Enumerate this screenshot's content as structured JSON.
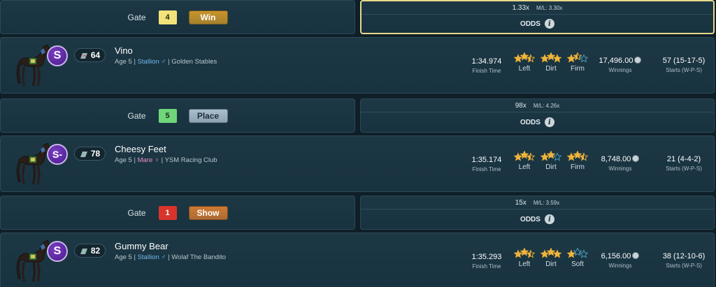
{
  "rows": [
    {
      "gate": {
        "label": "Gate",
        "number": "4",
        "number_bg": "#f3e27a",
        "result": "Win",
        "result_bg": "#c9942a"
      },
      "odds": {
        "value": "1.33x",
        "ml": "M/L: 3.30x",
        "label": "ODDS",
        "highlight": true
      },
      "horse": {
        "grade": "S",
        "rating": "64",
        "rating_trend": "down",
        "name": "Vino",
        "age": "Age 5",
        "gender": "Stallion ♂",
        "gender_type": "stallion",
        "stable": "Golden Stables",
        "finish_time": "1:34.974",
        "finish_time_caption": "Finish Time",
        "prefs": [
          {
            "label": "Left",
            "stars": 2.5
          },
          {
            "label": "Dirt",
            "stars": 3
          },
          {
            "label": "Firm",
            "stars": 1.5
          }
        ],
        "winnings": "17,496.00",
        "winnings_caption": "Winnings",
        "starts": "57 (15-17-5)",
        "starts_caption": "Starts (W-P-S)"
      }
    },
    {
      "gate": {
        "label": "Gate",
        "number": "5",
        "number_bg": "#6fd67a",
        "result": "Place",
        "result_bg": "#a9bfcf"
      },
      "odds": {
        "value": "98x",
        "ml": "M/L: 4.26x",
        "label": "ODDS",
        "highlight": false
      },
      "horse": {
        "grade": "S-",
        "rating": "78",
        "rating_trend": "up",
        "name": "Cheesy Feet",
        "age": "Age 5",
        "gender": "Mare ♀",
        "gender_type": "mare",
        "stable": "YSM Racing Club",
        "finish_time": "1:35.174",
        "finish_time_caption": "Finish Time",
        "prefs": [
          {
            "label": "Left",
            "stars": 2.5
          },
          {
            "label": "Dirt",
            "stars": 2
          },
          {
            "label": "Firm",
            "stars": 2.5
          }
        ],
        "winnings": "8,748.00",
        "winnings_caption": "Winnings",
        "starts": "21 (4-4-2)",
        "starts_caption": "Starts (W-P-S)"
      }
    },
    {
      "gate": {
        "label": "Gate",
        "number": "1",
        "number_bg": "#d9342b",
        "result": "Show",
        "result_bg": "#cf7a32"
      },
      "odds": {
        "value": "15x",
        "ml": "M/L: 3.59x",
        "label": "ODDS",
        "highlight": false
      },
      "horse": {
        "grade": "S",
        "rating": "82",
        "rating_trend": "up",
        "name": "Gummy Bear",
        "age": "Age 5",
        "gender": "Stallion ♂",
        "gender_type": "stallion",
        "stable": "Wolaf The Bandito",
        "finish_time": "1:35.293",
        "finish_time_caption": "Finish Time",
        "prefs": [
          {
            "label": "Left",
            "stars": 2.5
          },
          {
            "label": "Dirt",
            "stars": 3
          },
          {
            "label": "Soft",
            "stars": 1
          }
        ],
        "winnings": "6,156.00",
        "winnings_caption": "Winnings",
        "starts": "38 (12-10-6)",
        "starts_caption": "Starts (W-P-S)"
      }
    }
  ],
  "icons": {
    "info": "i",
    "coin": "coin-icon",
    "horse": "horse-icon",
    "rating": "rating-icon"
  },
  "colors": {
    "star": "#f0b33a",
    "star_empty": "#4fa3c4",
    "highlight_border": "#e8d98a"
  }
}
